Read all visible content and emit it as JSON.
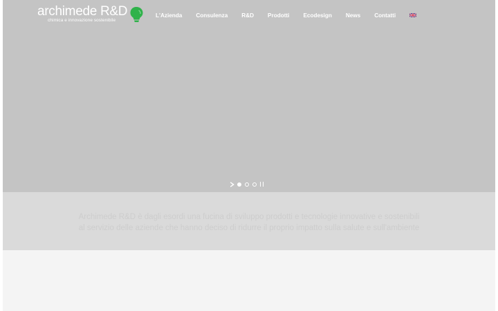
{
  "logo": {
    "name": "archimede R&D",
    "tagline": "chimica e innovazione sostenibile",
    "bulb_color": "#2fb24a"
  },
  "nav": {
    "items": [
      {
        "label": "L'Azienda"
      },
      {
        "label": "Consulenza"
      },
      {
        "label": "R&D"
      },
      {
        "label": "Prodotti"
      },
      {
        "label": "Ecodesign"
      },
      {
        "label": "News"
      },
      {
        "label": "Contatti"
      }
    ],
    "language_icon": "uk-flag-icon"
  },
  "slider": {
    "slide_count": 3,
    "active_slide": 1,
    "next_icon": "chevron-right-icon",
    "pause_icon": "pause-icon"
  },
  "intro": {
    "line1": "Archimede R&D è dagli esordi una fucina di sviluppo prodotti e tecnologie innovative e sostenibili",
    "line2": "al servizio delle aziende che hanno deciso di ridurre il proprio impatto sulla salute e sull'ambiente"
  },
  "colors": {
    "hero_bg": "#c4c4c4",
    "intro_bg": "#dadada",
    "lower_bg": "#f4f4f4",
    "brand_green": "#2fb24a"
  }
}
